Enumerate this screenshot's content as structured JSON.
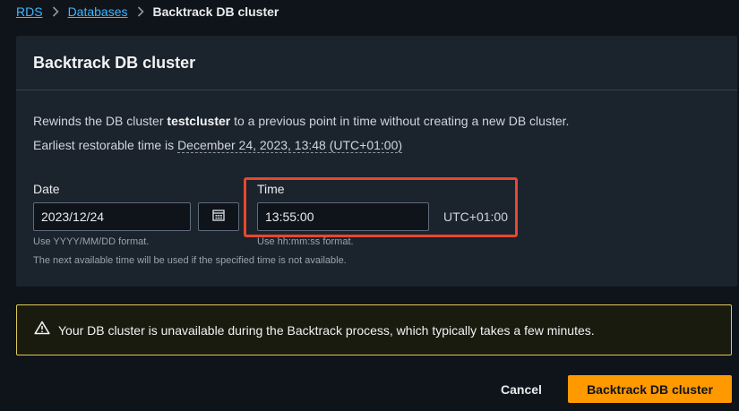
{
  "breadcrumb": {
    "items": [
      {
        "label": "RDS"
      },
      {
        "label": "Databases"
      }
    ],
    "current": "Backtrack DB cluster"
  },
  "panel": {
    "title": "Backtrack DB cluster",
    "desc_prefix": "Rewinds the DB cluster ",
    "cluster_name": "testcluster",
    "desc_suffix": " to a previous point in time without creating a new DB cluster.",
    "earliest_prefix": "Earliest restorable time is ",
    "earliest_value": "December 24, 2023, 13:48 (UTC+01:00)"
  },
  "form": {
    "date_label": "Date",
    "date_value": "2023/12/24",
    "date_hint": "Use YYYY/MM/DD format.",
    "time_label": "Time",
    "time_value": "13:55:00",
    "time_hint": "Use hh:mm:ss format.",
    "timezone": "UTC+01:00",
    "note": "The next available time will be used if the specified time is not available."
  },
  "alert": {
    "text": "Your DB cluster is unavailable during the Backtrack process, which typically takes a few minutes.",
    "color": "#e0ca57"
  },
  "actions": {
    "cancel_label": "Cancel",
    "submit_label": "Backtrack DB cluster",
    "accent": "#ff9900"
  },
  "icons": {
    "separator": "chevron-right-icon",
    "calendar": "calendar-icon",
    "warning": "warning-icon"
  }
}
